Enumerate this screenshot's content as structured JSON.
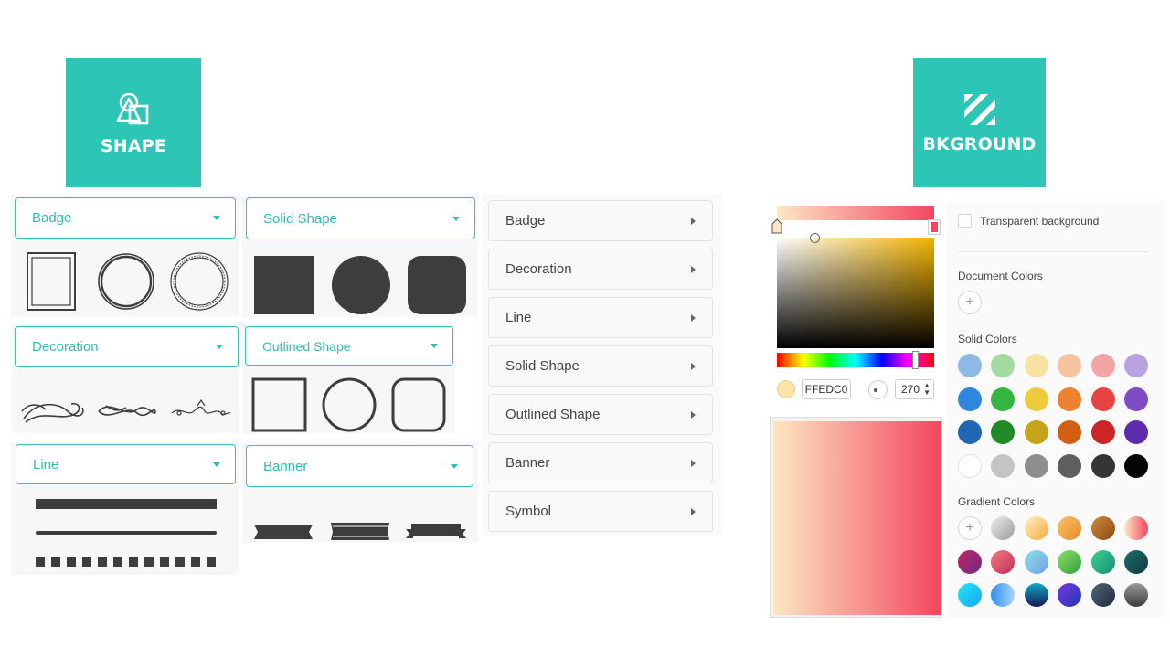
{
  "tiles": {
    "shape_label": "SHAPE",
    "background_label": "BKGROUND"
  },
  "dropdowns": {
    "badge": "Badge",
    "solid_shape": "Solid Shape",
    "decoration": "Decoration",
    "outlined_shape": "Outlined Shape",
    "line": "Line",
    "banner": "Banner"
  },
  "categories": [
    "Badge",
    "Decoration",
    "Line",
    "Solid Shape",
    "Outlined Shape",
    "Banner",
    "Symbol"
  ],
  "colorpicker": {
    "hex_value": "FFEDC0",
    "angle_value": "270"
  },
  "bgpanel": {
    "transparent_label": "Transparent background",
    "document_colors_title": "Document Colors",
    "solid_colors_title": "Solid Colors",
    "gradient_colors_title": "Gradient Colors",
    "solid_colors": [
      [
        "#8db8e8",
        "#a2dba0",
        "#f7e2a2",
        "#f6c4a0",
        "#f4a4a4",
        "#b9a2e0"
      ],
      [
        "#2e86de",
        "#35b542",
        "#eecb3c",
        "#ee8231",
        "#e84343",
        "#7d4cc6"
      ],
      [
        "#1f66b3",
        "#218a26",
        "#c5a31b",
        "#d45f12",
        "#cc2525",
        "#5e2ab0"
      ],
      [
        "#ffffff",
        "#c4c4c4",
        "#8e8e8e",
        "#5f5f5f",
        "#353535",
        "#050505"
      ]
    ],
    "gradient_colors": [
      [
        "add",
        "linear-gradient(135deg,#eee,#9a9a9a)",
        "linear-gradient(135deg,#fff1c4,#f3a83a)",
        "linear-gradient(135deg,#f8c16a,#ea8a2a)",
        "linear-gradient(135deg,#d08a3a,#8a4a14)",
        "linear-gradient(90deg,#fde7c3,#f3465f)"
      ],
      [
        "linear-gradient(135deg,#c1245e,#6e2b8a)",
        "linear-gradient(135deg,#f27a7a,#c32f5a)",
        "linear-gradient(135deg,#8ee0e6,#6f9ee6)",
        "linear-gradient(135deg,#8fe06a,#2f9e3a)",
        "linear-gradient(135deg,#3ed08e,#158f7a)",
        "linear-gradient(135deg,#1e6e6e,#0e3a3a)"
      ],
      [
        "linear-gradient(135deg,#22e3f8,#17a8f0)",
        "linear-gradient(90deg,#2f8cf5,#a9d6f8)",
        "linear-gradient(180deg,#12a7c4,#141858)",
        "linear-gradient(135deg,#7a36e0,#1f38b3)",
        "linear-gradient(135deg,#55667a,#1e2a38)",
        "linear-gradient(180deg,#9a9a9a,#3d3d3d)"
      ]
    ]
  },
  "colors": {
    "accent": "#2dc5b5",
    "shape_fill": "#3d3d3d"
  }
}
